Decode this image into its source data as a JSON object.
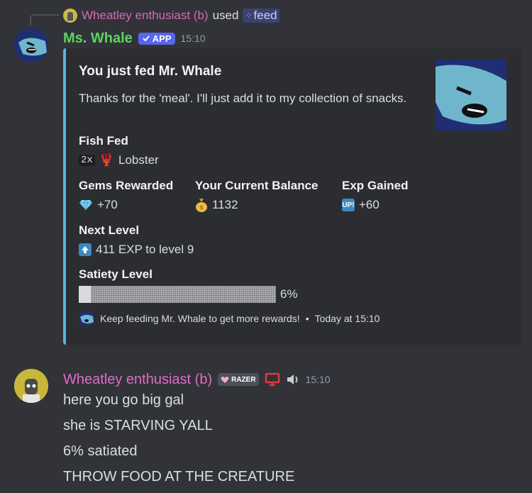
{
  "reply": {
    "user": "Wheatley enthusiast (b)",
    "used_text": "used",
    "command": "feed"
  },
  "bot_message": {
    "author": "Ms. Whale",
    "badge": "APP",
    "time": "15:10",
    "embed": {
      "accent_color": "#52b7e0",
      "title": "You just fed Mr. Whale",
      "description": "Thanks for the 'meal'. I'll just add it to my collection of snacks.",
      "fields": {
        "fish_fed": {
          "name": "Fish Fed",
          "count": "2x",
          "value": "Lobster"
        },
        "gems": {
          "name": "Gems Rewarded",
          "value": "+70"
        },
        "balance": {
          "name": "Your Current Balance",
          "value": "1132"
        },
        "exp": {
          "name": "Exp Gained",
          "value": "+60",
          "icon_text": "UP!"
        },
        "next_level": {
          "name": "Next Level",
          "value": "411 EXP to level 9"
        },
        "satiety": {
          "name": "Satiety Level",
          "percent_label": "6%",
          "fraction": 0.06
        }
      },
      "footer": {
        "text": "Keep feeding Mr. Whale to get more rewards!",
        "separator": "•",
        "timestamp": "Today at 15:10"
      }
    }
  },
  "user_message": {
    "author": "Wheatley enthusiast (b)",
    "badge_text": "RAZER",
    "time": "15:10",
    "lines": [
      "here you go big gal",
      "she is STARVING YALL",
      "6% satiated",
      "THROW FOOD AT THE CREATURE"
    ]
  },
  "colors": {
    "background": "#313338",
    "embed_background": "#2b2d31",
    "bot_name": "#5fd35f",
    "user_name": "#e56bc6",
    "app_badge": "#5865f2"
  }
}
